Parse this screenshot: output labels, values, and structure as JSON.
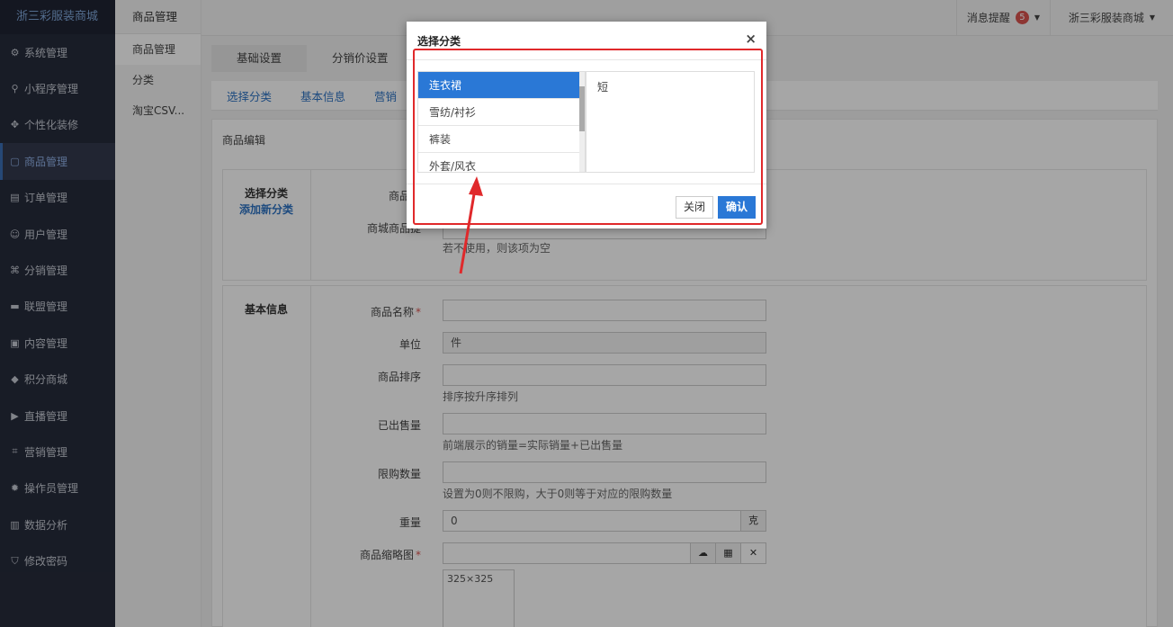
{
  "sidebar": {
    "brand": "浙三彩服装商城",
    "items": [
      {
        "label": "系统管理",
        "icon": "⚙",
        "name": "settings"
      },
      {
        "label": "小程序管理",
        "icon": "⚲",
        "name": "miniprogram"
      },
      {
        "label": "个性化装修",
        "icon": "✥",
        "name": "decoration"
      },
      {
        "label": "商品管理",
        "icon": "▢",
        "name": "goods"
      },
      {
        "label": "订单管理",
        "icon": "▤",
        "name": "orders"
      },
      {
        "label": "用户管理",
        "icon": "☺",
        "name": "users"
      },
      {
        "label": "分销管理",
        "icon": "⌘",
        "name": "distribution"
      },
      {
        "label": "联盟管理",
        "icon": "▬",
        "name": "alliance"
      },
      {
        "label": "内容管理",
        "icon": "▣",
        "name": "content"
      },
      {
        "label": "积分商城",
        "icon": "◆",
        "name": "points"
      },
      {
        "label": "直播管理",
        "icon": "▶",
        "name": "live"
      },
      {
        "label": "营销管理",
        "icon": "⌗",
        "name": "marketing"
      },
      {
        "label": "操作员管理",
        "icon": "✹",
        "name": "operators"
      },
      {
        "label": "数据分析",
        "icon": "▥",
        "name": "analytics"
      },
      {
        "label": "修改密码",
        "icon": "⛉",
        "name": "password"
      }
    ]
  },
  "subnav": {
    "title": "商品管理",
    "items": [
      "商品管理",
      "分类",
      "淘宝CSV..."
    ]
  },
  "topbar": {
    "messages_label": "消息提醒",
    "messages_count": "5",
    "user_label": "浙三彩服装商城"
  },
  "tabs": [
    "基础设置",
    "分销价设置"
  ],
  "subtabs": [
    "选择分类",
    "基本信息",
    "营销"
  ],
  "panel_title": "商品编辑",
  "category_section": {
    "label": "选择分类",
    "add_link": "添加新分类",
    "field_goods_category": "商品分",
    "field_mall_category": "商城商品提",
    "hint": "若不使用，则该项为空"
  },
  "basic_section": {
    "label": "基本信息",
    "fields": {
      "name_label": "商品名称",
      "unit_label": "单位",
      "unit_value": "件",
      "sort_label": "商品排序",
      "sort_hint": "排序按升序排列",
      "sold_label": "已出售量",
      "sold_hint": "前端展示的销量=实际销量+已出售量",
      "limit_label": "限购数量",
      "limit_hint": "设置为0则不限购，大于0则等于对应的限购数量",
      "weight_label": "重量",
      "weight_value": "0",
      "weight_unit": "克",
      "thumb_label": "商品缩略图",
      "thumb_size": "325×325"
    }
  },
  "modal": {
    "title": "选择分类",
    "close_symbol": "×",
    "categories": [
      "连衣裙",
      "雪纺/衬衫",
      "裤装",
      "外套/风衣"
    ],
    "subcategories": [
      "短"
    ],
    "btn_close": "关闭",
    "btn_ok": "确认"
  },
  "colors": {
    "sidebar_bg": "#262b3b",
    "accent": "#2a78d6",
    "annotation_red": "#e0292b",
    "badge_red": "#d9534f"
  }
}
